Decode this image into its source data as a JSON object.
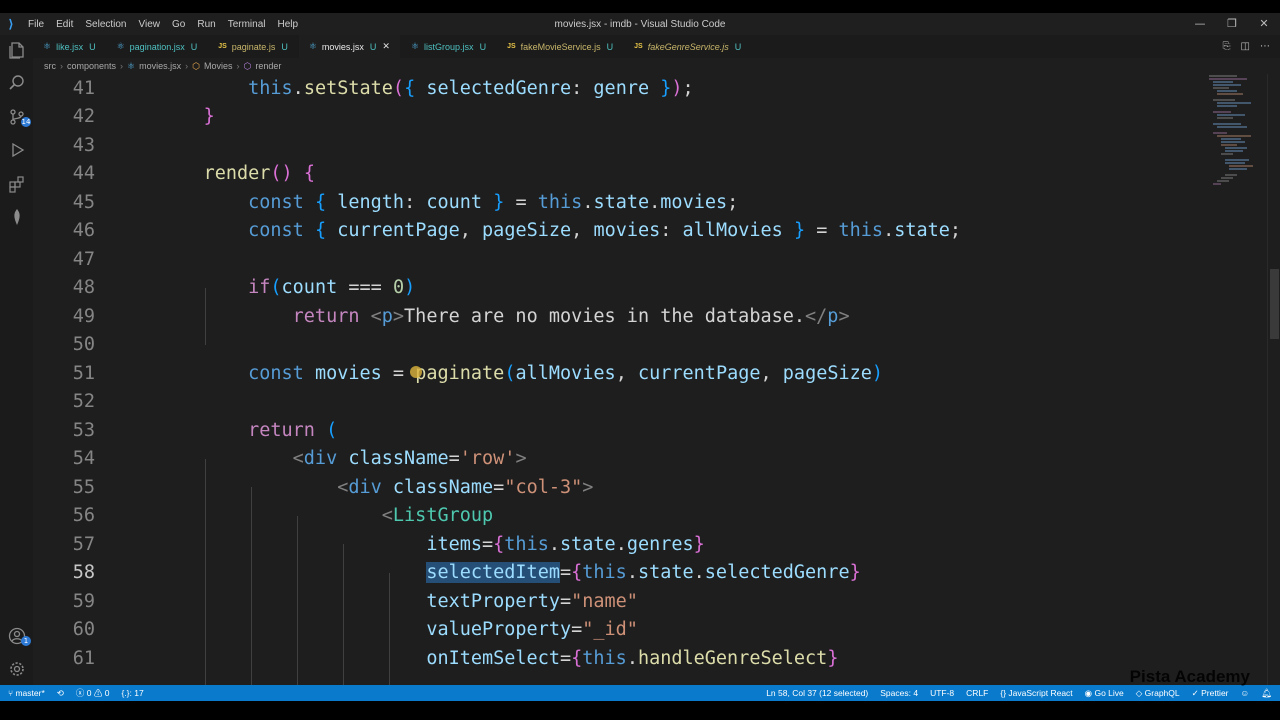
{
  "window": {
    "title": "movies.jsx - imdb - Visual Studio Code",
    "menu": [
      "File",
      "Edit",
      "Selection",
      "View",
      "Go",
      "Run",
      "Terminal",
      "Help"
    ]
  },
  "activity_bar": {
    "icons": [
      "explorer-icon",
      "search-icon",
      "source-control-icon",
      "run-debug-icon",
      "extensions-icon",
      "mongodb-icon",
      "account-icon",
      "settings-gear-icon"
    ],
    "source_control_badge": "14",
    "account_badge": "1"
  },
  "tabs": [
    {
      "name": "like.jsx",
      "status": "U",
      "type": "react",
      "active": false
    },
    {
      "name": "pagination.jsx",
      "status": "U",
      "type": "react",
      "active": false
    },
    {
      "name": "paginate.js",
      "status": "U",
      "type": "js",
      "active": false
    },
    {
      "name": "movies.jsx",
      "status": "U",
      "type": "react",
      "active": true
    },
    {
      "name": "listGroup.jsx",
      "status": "U",
      "type": "react",
      "active": false
    },
    {
      "name": "fakeMovieService.js",
      "status": "U",
      "type": "js",
      "active": false
    },
    {
      "name": "fakeGenreService.js",
      "status": "U",
      "type": "js",
      "active": false
    }
  ],
  "breadcrumb": [
    "src",
    "components",
    "movies.jsx",
    "Movies",
    "render"
  ],
  "editor": {
    "active_line": "58",
    "line_numbers": [
      "41",
      "42",
      "43",
      "44",
      "45",
      "46",
      "47",
      "48",
      "49",
      "50",
      "51",
      "52",
      "53",
      "54",
      "55",
      "56",
      "57",
      "58",
      "59",
      "60",
      "61"
    ]
  },
  "status_bar": {
    "branch": "master*",
    "errors": "0",
    "warnings": "0",
    "position_hint": "{.}: 17",
    "cursor": "Ln 58, Col 37 (12 selected)",
    "spaces": "Spaces: 4",
    "encoding": "UTF-8",
    "eol": "CRLF",
    "language": "JavaScript React",
    "go_live": "Go Live",
    "graphql": "GraphQL",
    "prettier": "Prettier"
  },
  "watermark": "Pista Academy",
  "colors": {
    "status_bar": "#0a7acc",
    "editor_bg": "#1e1e1e",
    "keyword": "#c586c0",
    "variable": "#9cdcfe",
    "string": "#ce9178"
  }
}
